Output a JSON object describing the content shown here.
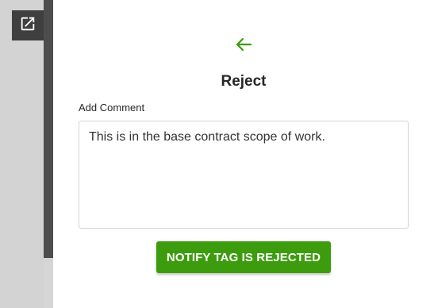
{
  "panel": {
    "title": "Reject",
    "comment_label": "Add Comment",
    "comment_value": "This is in the base contract scope of work.",
    "notify_button_label": "NOTIFY TAG IS REJECTED"
  },
  "icons": {
    "popout": "open-in-new-icon",
    "back": "arrow-left-icon"
  },
  "colors": {
    "accent": "#3d9c0e",
    "popout_bg": "#3f3f3f",
    "scroll_thumb": "#4d4d4d"
  }
}
